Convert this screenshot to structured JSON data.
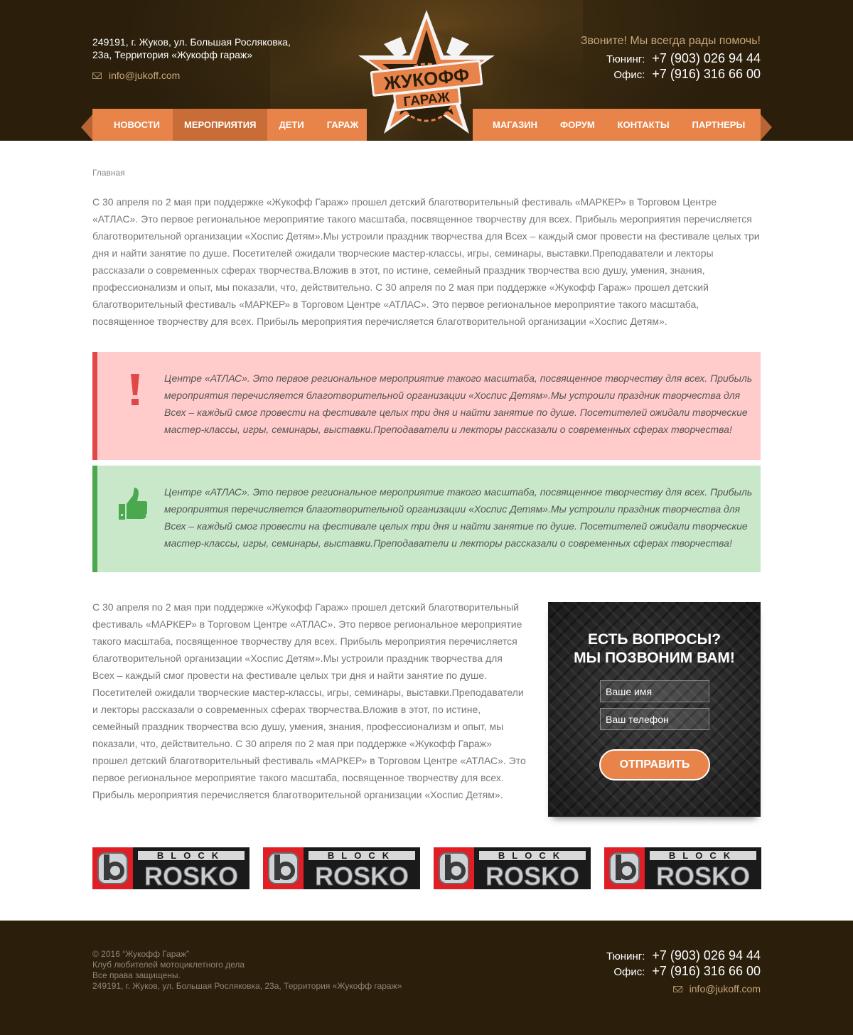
{
  "header": {
    "address": "249191, г. Жуков, ул. Большая Росляковка, 23а, Территория «Жукофф гараж»",
    "email": "info@jukoff.com",
    "call_text": "Звоните! Мы всегда рады помочь!",
    "phones": [
      {
        "label": "Тюнинг:",
        "number": "+7 (903) 026 94 44"
      },
      {
        "label": "Офис:",
        "number": "+7 (916) 316 66 00"
      }
    ],
    "logo": {
      "line1": "ЖУКОФФ",
      "line2": "ГАРАЖ"
    }
  },
  "nav": {
    "left": [
      {
        "label": "Новости",
        "active": false
      },
      {
        "label": "Мероприятия",
        "active": true
      },
      {
        "label": "Дети",
        "active": false
      },
      {
        "label": "Гараж",
        "active": false
      }
    ],
    "right": [
      {
        "label": "Магазин"
      },
      {
        "label": "Форум"
      },
      {
        "label": "Контакты"
      },
      {
        "label": "Партнеры"
      }
    ]
  },
  "breadcrumb": "Главная",
  "intro_text": "С 30 апреля по 2 мая при поддержке «Жукофф Гараж» прошел детский благотворительный фестиваль «МАРКЕР» в Торговом Центре «АТЛАС». Это первое региональное мероприятие такого масштаба, посвященное творчеству для всех. Прибыль мероприятия перечисляется благотворительной организации «Хоспис Детям».Мы устроили праздник творчества для Всех – каждый смог провести на фестивале целых три дня и найти занятие по душе. Посетителей ожидали творческие мастер-классы, игры, семинары, выставки.Преподаватели и лекторы рассказали о современных сферах творчества.Вложив в этот, по истине, семейный праздник творчества всю душу, умения, знания, профессионализм и опыт, мы показали, что, действительно. С 30 апреля по 2 мая при поддержке «Жукофф Гараж» прошел детский благотворительный фестиваль «МАРКЕР» в Торговом Центре «АТЛАС». Это первое региональное мероприятие такого масштаба, посвященное творчеству для всех. Прибыль мероприятия перечисляется благотворительной организации «Хоспис Детям».",
  "alerts": {
    "warning": {
      "icon": "exclamation-icon",
      "color": "#e04848",
      "text": "Центре «АТЛАС». Это первое региональное мероприятие такого масштаба, посвященное творчеству для всех. Прибыль мероприятия перечисляется благотворительной организации «Хоспис Детям».Мы устроили праздник творчества для Всех – каждый смог провести на фестивале целых три дня и найти занятие по душе. Посетителей ожидали творческие мастер-классы, игры, семинары, выставки.Преподаватели и лекторы рассказали о современных сферах творчества!"
    },
    "success": {
      "icon": "thumbs-up-icon",
      "color": "#4aa84f",
      "text": "Центре «АТЛАС». Это первое региональное мероприятие такого масштаба, посвященное творчеству для всех. Прибыль мероприятия перечисляется благотворительной организации «Хоспис Детям».Мы устроили праздник творчества для Всех – каждый смог провести на фестивале целых три дня и найти занятие по душе. Посетителей ожидали творческие мастер-классы, игры, семинары, выставки.Преподаватели и лекторы рассказали о современных сферах творчества!"
    }
  },
  "body_text": "С 30 апреля по 2 мая при поддержке «Жукофф Гараж» прошел детский благотворительный фестиваль «МАРКЕР» в Торговом Центре «АТЛАС». Это первое региональное мероприятие такого масштаба, посвященное творчеству для всех. Прибыль мероприятия перечисляется благотворительной организации «Хоспис Детям».Мы устроили праздник творчества для Всех – каждый смог провести на фестивале целых три дня и найти занятие по душе. Посетителей ожидали творческие мастер-классы, игры, семинары, выставки.Преподаватели и лекторы рассказали о современных сферах творчества.Вложив в этот, по истине, семейный праздник творчества всю душу, умения, знания, профессионализм и опыт, мы показали, что, действительно. С 30 апреля по 2 мая при поддержке «Жукофф Гараж» прошел детский благотворительный фестиваль «МАРКЕР» в Торговом Центре «АТЛАС». Это первое региональное мероприятие такого масштаба, посвященное творчеству для всех. Прибыль мероприятия перечисляется благотворительной организации «Хоспис Детям».",
  "callback": {
    "title_line1": "ЕСТЬ ВОПРОСЫ?",
    "title_line2": "МЫ ПОЗВОНИМ ВАМ!",
    "name_placeholder": "Ваше имя",
    "phone_placeholder": "Ваш телефон",
    "submit_label": "Отправить"
  },
  "partners": [
    {
      "word1": "BLOCK",
      "word2": "ROSKO"
    },
    {
      "word1": "BLOCK",
      "word2": "ROSKO"
    },
    {
      "word1": "BLOCK",
      "word2": "ROSKO"
    },
    {
      "word1": "BLOCK",
      "word2": "ROSKO"
    }
  ],
  "footer": {
    "copyright": "© 2016 “Жукофф Гараж”",
    "club": "Клуб любителей мотоциклетного дела",
    "rights": "Все права защищены.",
    "address": "249191, г. Жуков, ул. Большая Росляковка, 23а, Территория «Жукофф гараж»",
    "phones": [
      {
        "label": "Тюнинг:",
        "number": "+7 (903) 026 94 44"
      },
      {
        "label": "Офис:",
        "number": "+7 (916) 316 66 00"
      }
    ],
    "email": "info@jukoff.com"
  },
  "colors": {
    "accent": "#e8834a",
    "header_bg": "#2b1f0c",
    "warning": "#e04848",
    "success": "#4aa84f"
  }
}
